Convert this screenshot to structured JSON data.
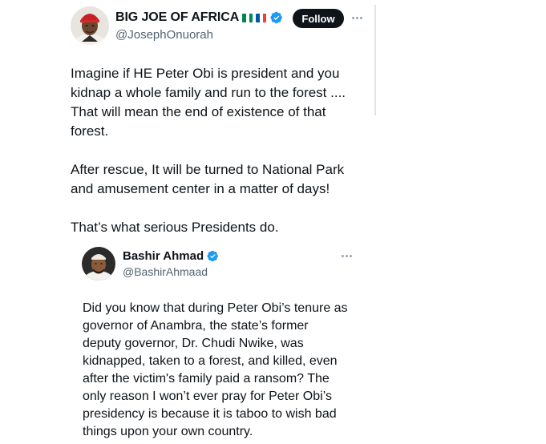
{
  "main_tweet": {
    "display_name": "BIG JOE OF AFRICA",
    "handle": "@JosephOnuorah",
    "follow_label": "Follow",
    "text": "Imagine if HE Peter Obi is president and you\nkidnap a whole family and run to the forest ....\nThat will mean the end of existence of that\nforest.\n\nAfter rescue, It will be turned to National Park\nand amusement center in a matter of days!\n\nThat’s what serious Presidents do."
  },
  "quoted_tweet": {
    "display_name": "Bashir Ahmad",
    "handle": "@BashirAhmaad",
    "text": "Did you know that during Peter Obi’s tenure as\ngovernor of Anambra, the state’s former\ndeputy governor, Dr. Chudi Nwike, was\nkidnapped, taken to a forest, and killed, even\nafter the victim's family paid a ransom? The\nonly reason I won’t ever pray for Peter Obi’s\npresidency is because it is taboo to wish bad\nthings upon your own country."
  },
  "colors": {
    "verified": "#1d9bf0",
    "follow_bg": "#0f1419",
    "handle_gray": "#536471",
    "nigeria_green": "#008751",
    "france_blue": "#0055a4",
    "france_red": "#ef4135"
  },
  "icons": {
    "verified": "verified-badge-icon",
    "more": "more-horizontal-icon",
    "flags": [
      "nigeria-flag-icon",
      "france-flag-icon"
    ]
  }
}
